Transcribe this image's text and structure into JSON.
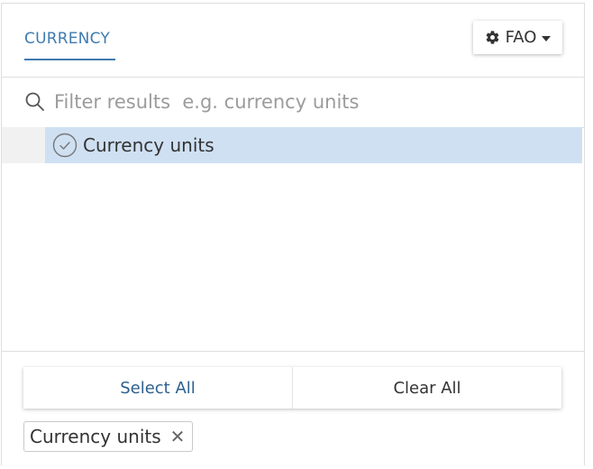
{
  "header": {
    "tab_label": "CURRENCY",
    "source_label": "FAO"
  },
  "filter": {
    "placeholder": "Filter results  e.g. currency units",
    "value": ""
  },
  "list": {
    "items": [
      {
        "label": "Currency units",
        "selected": true
      }
    ]
  },
  "footer": {
    "select_all_label": "Select All",
    "clear_all_label": "Clear All",
    "chips": [
      {
        "label": "Currency units",
        "remove_symbol": "✕"
      }
    ]
  },
  "colors": {
    "accent": "#3f7bb0",
    "selected_row": "#cfe0f2"
  }
}
